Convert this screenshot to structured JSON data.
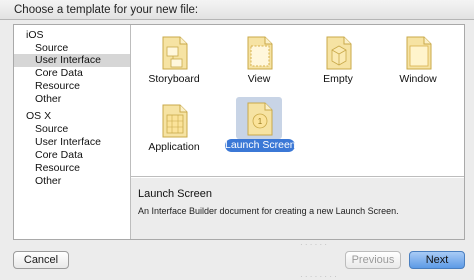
{
  "header": {
    "title": "Choose a template for your new file:"
  },
  "sidebar": {
    "items": [
      {
        "label": "iOS",
        "kind": "section"
      },
      {
        "label": "Source",
        "kind": "sub"
      },
      {
        "label": "User Interface",
        "kind": "sub",
        "selected": true
      },
      {
        "label": "Core Data",
        "kind": "sub"
      },
      {
        "label": "Resource",
        "kind": "sub"
      },
      {
        "label": "Other",
        "kind": "sub"
      },
      {
        "label": "OS X",
        "kind": "section"
      },
      {
        "label": "Source",
        "kind": "sub"
      },
      {
        "label": "User Interface",
        "kind": "sub"
      },
      {
        "label": "Core Data",
        "kind": "sub"
      },
      {
        "label": "Resource",
        "kind": "sub"
      },
      {
        "label": "Other",
        "kind": "sub"
      }
    ]
  },
  "templates": [
    {
      "label": "Storyboard",
      "icon": "storyboard-file-icon"
    },
    {
      "label": "View",
      "icon": "view-file-icon"
    },
    {
      "label": "Empty",
      "icon": "empty-file-icon"
    },
    {
      "label": "Window",
      "icon": "window-file-icon"
    },
    {
      "label": "Application",
      "icon": "application-file-icon"
    },
    {
      "label": "Launch Screen",
      "icon": "launch-screen-file-icon",
      "selected": true
    }
  ],
  "description": {
    "title": "Launch Screen",
    "text": "An Interface Builder document for creating a new Launch Screen."
  },
  "buttons": {
    "cancel": "Cancel",
    "previous": "Previous",
    "next": "Next"
  },
  "colors": {
    "selection": "#3b78d6",
    "accent": "#5d9ae6",
    "file_yellow": "#f2d77a"
  }
}
